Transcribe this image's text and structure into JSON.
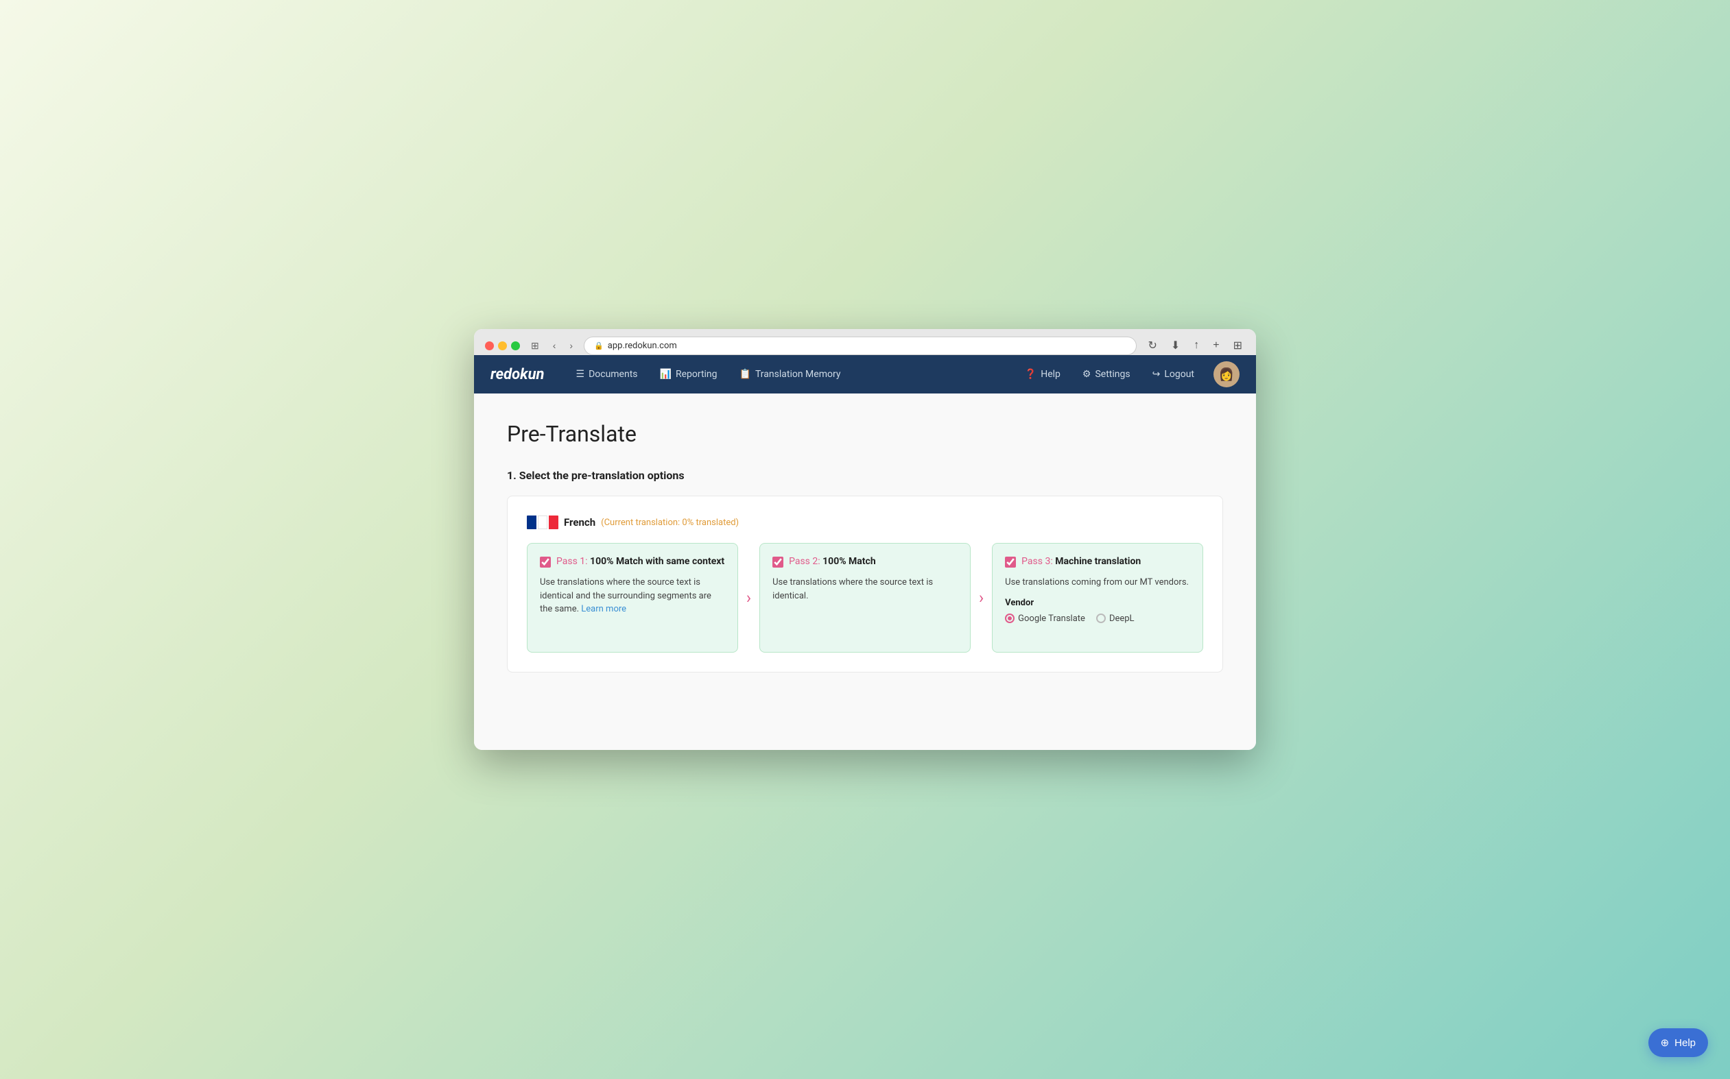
{
  "browser": {
    "url": "app.redokun.com",
    "tab_label": "app.redokun.com"
  },
  "navbar": {
    "logo": "redokun",
    "links": [
      {
        "id": "documents",
        "icon": "☰",
        "label": "Documents"
      },
      {
        "id": "reporting",
        "icon": "📊",
        "label": "Reporting"
      },
      {
        "id": "translation-memory",
        "icon": "📋",
        "label": "Translation Memory"
      }
    ],
    "right_links": [
      {
        "id": "help",
        "icon": "❓",
        "label": "Help"
      },
      {
        "id": "settings",
        "icon": "⚙",
        "label": "Settings"
      },
      {
        "id": "logout",
        "icon": "↪",
        "label": "Logout"
      }
    ]
  },
  "page": {
    "title": "Pre-Translate",
    "section_heading": "1. Select the pre-translation options"
  },
  "language": {
    "name": "French",
    "status": "(Current translation: 0% translated)"
  },
  "passes": [
    {
      "id": "pass1",
      "checked": true,
      "label": "Pass 1:",
      "title": "100% Match with same context",
      "description": "Use translations where the source text is identical and the surrounding segments are the same.",
      "learn_more_label": "Learn more",
      "learn_more_url": "#"
    },
    {
      "id": "pass2",
      "checked": true,
      "label": "Pass 2:",
      "title": "100% Match",
      "description": "Use translations where the source text is identical.",
      "learn_more_label": "",
      "learn_more_url": ""
    },
    {
      "id": "pass3",
      "checked": true,
      "label": "Pass 3:",
      "title": "Machine translation",
      "description": "Use translations coming from our MT vendors.",
      "vendor_label": "Vendor",
      "vendors": [
        {
          "id": "google",
          "label": "Google Translate",
          "selected": true
        },
        {
          "id": "deepl",
          "label": "DeepL",
          "selected": false
        }
      ]
    }
  ],
  "help_fab": {
    "label": "Help"
  }
}
